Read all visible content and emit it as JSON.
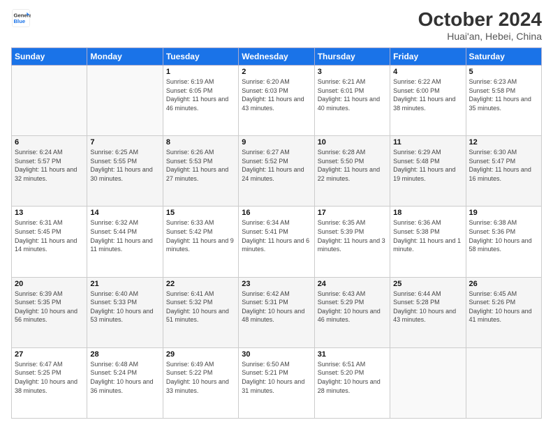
{
  "header": {
    "logo_line1": "General",
    "logo_line2": "Blue",
    "title": "October 2024",
    "subtitle": "Huai'an, Hebei, China"
  },
  "weekdays": [
    "Sunday",
    "Monday",
    "Tuesday",
    "Wednesday",
    "Thursday",
    "Friday",
    "Saturday"
  ],
  "weeks": [
    [
      {
        "day": "",
        "sunrise": "",
        "sunset": "",
        "daylight": ""
      },
      {
        "day": "",
        "sunrise": "",
        "sunset": "",
        "daylight": ""
      },
      {
        "day": "1",
        "sunrise": "Sunrise: 6:19 AM",
        "sunset": "Sunset: 6:05 PM",
        "daylight": "Daylight: 11 hours and 46 minutes."
      },
      {
        "day": "2",
        "sunrise": "Sunrise: 6:20 AM",
        "sunset": "Sunset: 6:03 PM",
        "daylight": "Daylight: 11 hours and 43 minutes."
      },
      {
        "day": "3",
        "sunrise": "Sunrise: 6:21 AM",
        "sunset": "Sunset: 6:01 PM",
        "daylight": "Daylight: 11 hours and 40 minutes."
      },
      {
        "day": "4",
        "sunrise": "Sunrise: 6:22 AM",
        "sunset": "Sunset: 6:00 PM",
        "daylight": "Daylight: 11 hours and 38 minutes."
      },
      {
        "day": "5",
        "sunrise": "Sunrise: 6:23 AM",
        "sunset": "Sunset: 5:58 PM",
        "daylight": "Daylight: 11 hours and 35 minutes."
      }
    ],
    [
      {
        "day": "6",
        "sunrise": "Sunrise: 6:24 AM",
        "sunset": "Sunset: 5:57 PM",
        "daylight": "Daylight: 11 hours and 32 minutes."
      },
      {
        "day": "7",
        "sunrise": "Sunrise: 6:25 AM",
        "sunset": "Sunset: 5:55 PM",
        "daylight": "Daylight: 11 hours and 30 minutes."
      },
      {
        "day": "8",
        "sunrise": "Sunrise: 6:26 AM",
        "sunset": "Sunset: 5:53 PM",
        "daylight": "Daylight: 11 hours and 27 minutes."
      },
      {
        "day": "9",
        "sunrise": "Sunrise: 6:27 AM",
        "sunset": "Sunset: 5:52 PM",
        "daylight": "Daylight: 11 hours and 24 minutes."
      },
      {
        "day": "10",
        "sunrise": "Sunrise: 6:28 AM",
        "sunset": "Sunset: 5:50 PM",
        "daylight": "Daylight: 11 hours and 22 minutes."
      },
      {
        "day": "11",
        "sunrise": "Sunrise: 6:29 AM",
        "sunset": "Sunset: 5:48 PM",
        "daylight": "Daylight: 11 hours and 19 minutes."
      },
      {
        "day": "12",
        "sunrise": "Sunrise: 6:30 AM",
        "sunset": "Sunset: 5:47 PM",
        "daylight": "Daylight: 11 hours and 16 minutes."
      }
    ],
    [
      {
        "day": "13",
        "sunrise": "Sunrise: 6:31 AM",
        "sunset": "Sunset: 5:45 PM",
        "daylight": "Daylight: 11 hours and 14 minutes."
      },
      {
        "day": "14",
        "sunrise": "Sunrise: 6:32 AM",
        "sunset": "Sunset: 5:44 PM",
        "daylight": "Daylight: 11 hours and 11 minutes."
      },
      {
        "day": "15",
        "sunrise": "Sunrise: 6:33 AM",
        "sunset": "Sunset: 5:42 PM",
        "daylight": "Daylight: 11 hours and 9 minutes."
      },
      {
        "day": "16",
        "sunrise": "Sunrise: 6:34 AM",
        "sunset": "Sunset: 5:41 PM",
        "daylight": "Daylight: 11 hours and 6 minutes."
      },
      {
        "day": "17",
        "sunrise": "Sunrise: 6:35 AM",
        "sunset": "Sunset: 5:39 PM",
        "daylight": "Daylight: 11 hours and 3 minutes."
      },
      {
        "day": "18",
        "sunrise": "Sunrise: 6:36 AM",
        "sunset": "Sunset: 5:38 PM",
        "daylight": "Daylight: 11 hours and 1 minute."
      },
      {
        "day": "19",
        "sunrise": "Sunrise: 6:38 AM",
        "sunset": "Sunset: 5:36 PM",
        "daylight": "Daylight: 10 hours and 58 minutes."
      }
    ],
    [
      {
        "day": "20",
        "sunrise": "Sunrise: 6:39 AM",
        "sunset": "Sunset: 5:35 PM",
        "daylight": "Daylight: 10 hours and 56 minutes."
      },
      {
        "day": "21",
        "sunrise": "Sunrise: 6:40 AM",
        "sunset": "Sunset: 5:33 PM",
        "daylight": "Daylight: 10 hours and 53 minutes."
      },
      {
        "day": "22",
        "sunrise": "Sunrise: 6:41 AM",
        "sunset": "Sunset: 5:32 PM",
        "daylight": "Daylight: 10 hours and 51 minutes."
      },
      {
        "day": "23",
        "sunrise": "Sunrise: 6:42 AM",
        "sunset": "Sunset: 5:31 PM",
        "daylight": "Daylight: 10 hours and 48 minutes."
      },
      {
        "day": "24",
        "sunrise": "Sunrise: 6:43 AM",
        "sunset": "Sunset: 5:29 PM",
        "daylight": "Daylight: 10 hours and 46 minutes."
      },
      {
        "day": "25",
        "sunrise": "Sunrise: 6:44 AM",
        "sunset": "Sunset: 5:28 PM",
        "daylight": "Daylight: 10 hours and 43 minutes."
      },
      {
        "day": "26",
        "sunrise": "Sunrise: 6:45 AM",
        "sunset": "Sunset: 5:26 PM",
        "daylight": "Daylight: 10 hours and 41 minutes."
      }
    ],
    [
      {
        "day": "27",
        "sunrise": "Sunrise: 6:47 AM",
        "sunset": "Sunset: 5:25 PM",
        "daylight": "Daylight: 10 hours and 38 minutes."
      },
      {
        "day": "28",
        "sunrise": "Sunrise: 6:48 AM",
        "sunset": "Sunset: 5:24 PM",
        "daylight": "Daylight: 10 hours and 36 minutes."
      },
      {
        "day": "29",
        "sunrise": "Sunrise: 6:49 AM",
        "sunset": "Sunset: 5:22 PM",
        "daylight": "Daylight: 10 hours and 33 minutes."
      },
      {
        "day": "30",
        "sunrise": "Sunrise: 6:50 AM",
        "sunset": "Sunset: 5:21 PM",
        "daylight": "Daylight: 10 hours and 31 minutes."
      },
      {
        "day": "31",
        "sunrise": "Sunrise: 6:51 AM",
        "sunset": "Sunset: 5:20 PM",
        "daylight": "Daylight: 10 hours and 28 minutes."
      },
      {
        "day": "",
        "sunrise": "",
        "sunset": "",
        "daylight": ""
      },
      {
        "day": "",
        "sunrise": "",
        "sunset": "",
        "daylight": ""
      }
    ]
  ]
}
